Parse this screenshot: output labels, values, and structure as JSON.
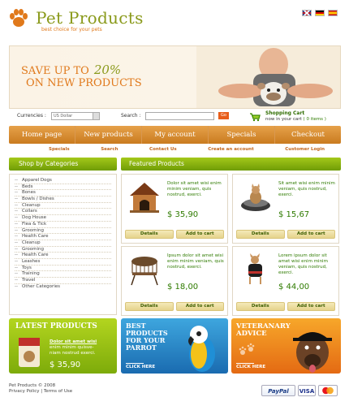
{
  "header": {
    "title": "Pet Products",
    "subtitle": "best choice for your pets",
    "flags": [
      "flag-uk-icon",
      "flag-de-icon",
      "flag-es-icon"
    ]
  },
  "banner": {
    "save_text": "SAVE UP TO",
    "percent": "20%",
    "line2": "ON NEW PRODUCTS"
  },
  "toolbar": {
    "currencies_label": "Currencies :",
    "currency_value": "US Dollar",
    "search_label": "Search :",
    "search_value": "",
    "go_label": "Go",
    "cart_title": "Shopping Cart",
    "cart_text": "now in your cart",
    "cart_count": "( 0 items )"
  },
  "nav": {
    "items": [
      "Home page",
      "New products",
      "My account",
      "Specials",
      "Checkout"
    ]
  },
  "subnav": {
    "items": [
      "Specials",
      "Search",
      "Contact Us",
      "Create an account",
      "Customer Login"
    ]
  },
  "sidebar": {
    "title": "Shop by Categories",
    "items": [
      "Apparel Dogs",
      "Beds",
      "Bones",
      "Bowls / Dishes",
      "Cleanup",
      "Collars",
      "Dog House",
      "Flea & Tick",
      "Grooming",
      "Health Care",
      "Cleanup",
      "Grooming",
      "Health Care",
      "Leashes",
      "Toys",
      "Training",
      "Travel",
      "Other Categories"
    ]
  },
  "featured": {
    "title": "Featured Products",
    "details_label": "Details",
    "add_label": "Add to cart",
    "products": [
      {
        "desc": "Dolor sit amet wisi enim  minim veniam, quis nostrud, exerci.",
        "price": "$ 35,90",
        "image": "dog-house-image"
      },
      {
        "desc": "Sit amet wisi enim minim veniam, quis nostrud, exerci.",
        "price": "$ 15,67",
        "image": "cat-bed-image"
      },
      {
        "desc": "Ipsum dolor sit amet wisi enim minim veniam, quis nostrud, exerci.",
        "price": "$ 18,00",
        "image": "bird-cage-image"
      },
      {
        "desc": "Lorem ipsum dolor sit amet wisi enim minim veniam, quis nostrud, exerci.",
        "price": "$ 44,00",
        "image": "dog-coat-image"
      }
    ]
  },
  "promos": {
    "latest_title": "LATEST PRODUCTS",
    "latest_line1": "Dolor sit amet wisi",
    "latest_line2": "enim  minim quisve-",
    "latest_line3": "niam nostrud exerci.",
    "latest_price": "$ 35,90",
    "parrot_line1": "BEST",
    "parrot_line2": "PRODUCTS",
    "parrot_line3": "FOR YOUR",
    "parrot_line4": "PARROT",
    "vet_line1": "VETERANARY",
    "vet_line2": "ADVICE",
    "click_here": "CLICK HERE"
  },
  "footer": {
    "copyright": "Pet Products © 2008",
    "links": "Privacy Policy | Terms of Use",
    "payments": [
      "PayPal",
      "VISA",
      "MasterCard"
    ]
  },
  "colors": {
    "brand_green": "#8a9a1b",
    "brand_orange": "#e0791b",
    "nav_orange": "#d8902f",
    "header_green": "#7fae0c",
    "parrot_blue": "#2a86c7",
    "vet_orange": "#f08a1d"
  }
}
